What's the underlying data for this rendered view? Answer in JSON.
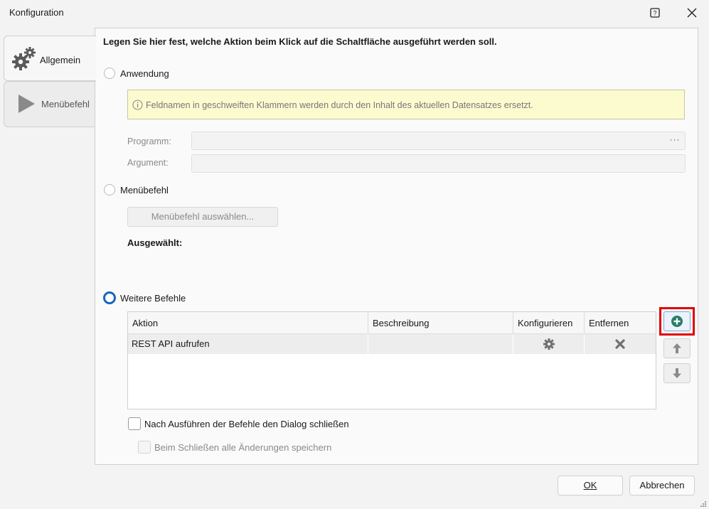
{
  "window": {
    "title": "Konfiguration"
  },
  "tabs": [
    {
      "label": "Allgemein",
      "icon": "gears-icon",
      "selected": true
    },
    {
      "label": "Menübefehl",
      "icon": "play-icon",
      "selected": false
    }
  ],
  "heading": "Legen Sie hier fest, welche Aktion beim Klick auf die Schaltfläche ausgeführt werden soll.",
  "options": {
    "anwendung": {
      "label": "Anwendung",
      "selected": false
    },
    "menuebefehl": {
      "label": "Menübefehl",
      "selected": false
    },
    "weitere": {
      "label": "Weitere Befehle",
      "selected": true
    }
  },
  "info": {
    "text": "Feldnamen in geschweiften Klammern werden durch den Inhalt des aktuellen Datensatzes ersetzt."
  },
  "fields": {
    "programm": {
      "label": "Programm:",
      "value": "",
      "browse": "···"
    },
    "argument": {
      "label": "Argument:",
      "value": ""
    }
  },
  "menu_select_button": "Menübefehl auswählen...",
  "selected_label": "Ausgewählt:",
  "table": {
    "columns": [
      "Aktion",
      "Beschreibung",
      "Konfigurieren",
      "Entfernen"
    ],
    "rows": [
      {
        "aktion": "REST API aufrufen",
        "beschreibung": ""
      }
    ]
  },
  "checkboxes": {
    "close_dialog": {
      "label": "Nach Ausführen der Befehle den Dialog schließen",
      "checked": false
    },
    "save_changes": {
      "label": "Beim Schließen alle Änderungen speichern",
      "checked": false,
      "disabled": true
    }
  },
  "buttons": {
    "ok": "OK",
    "cancel": "Abbrechen"
  },
  "colors": {
    "accent": "#1565c0",
    "highlight": "#e00000",
    "info_bg": "#fbfbcf",
    "add_icon": "#2e7d6a"
  }
}
